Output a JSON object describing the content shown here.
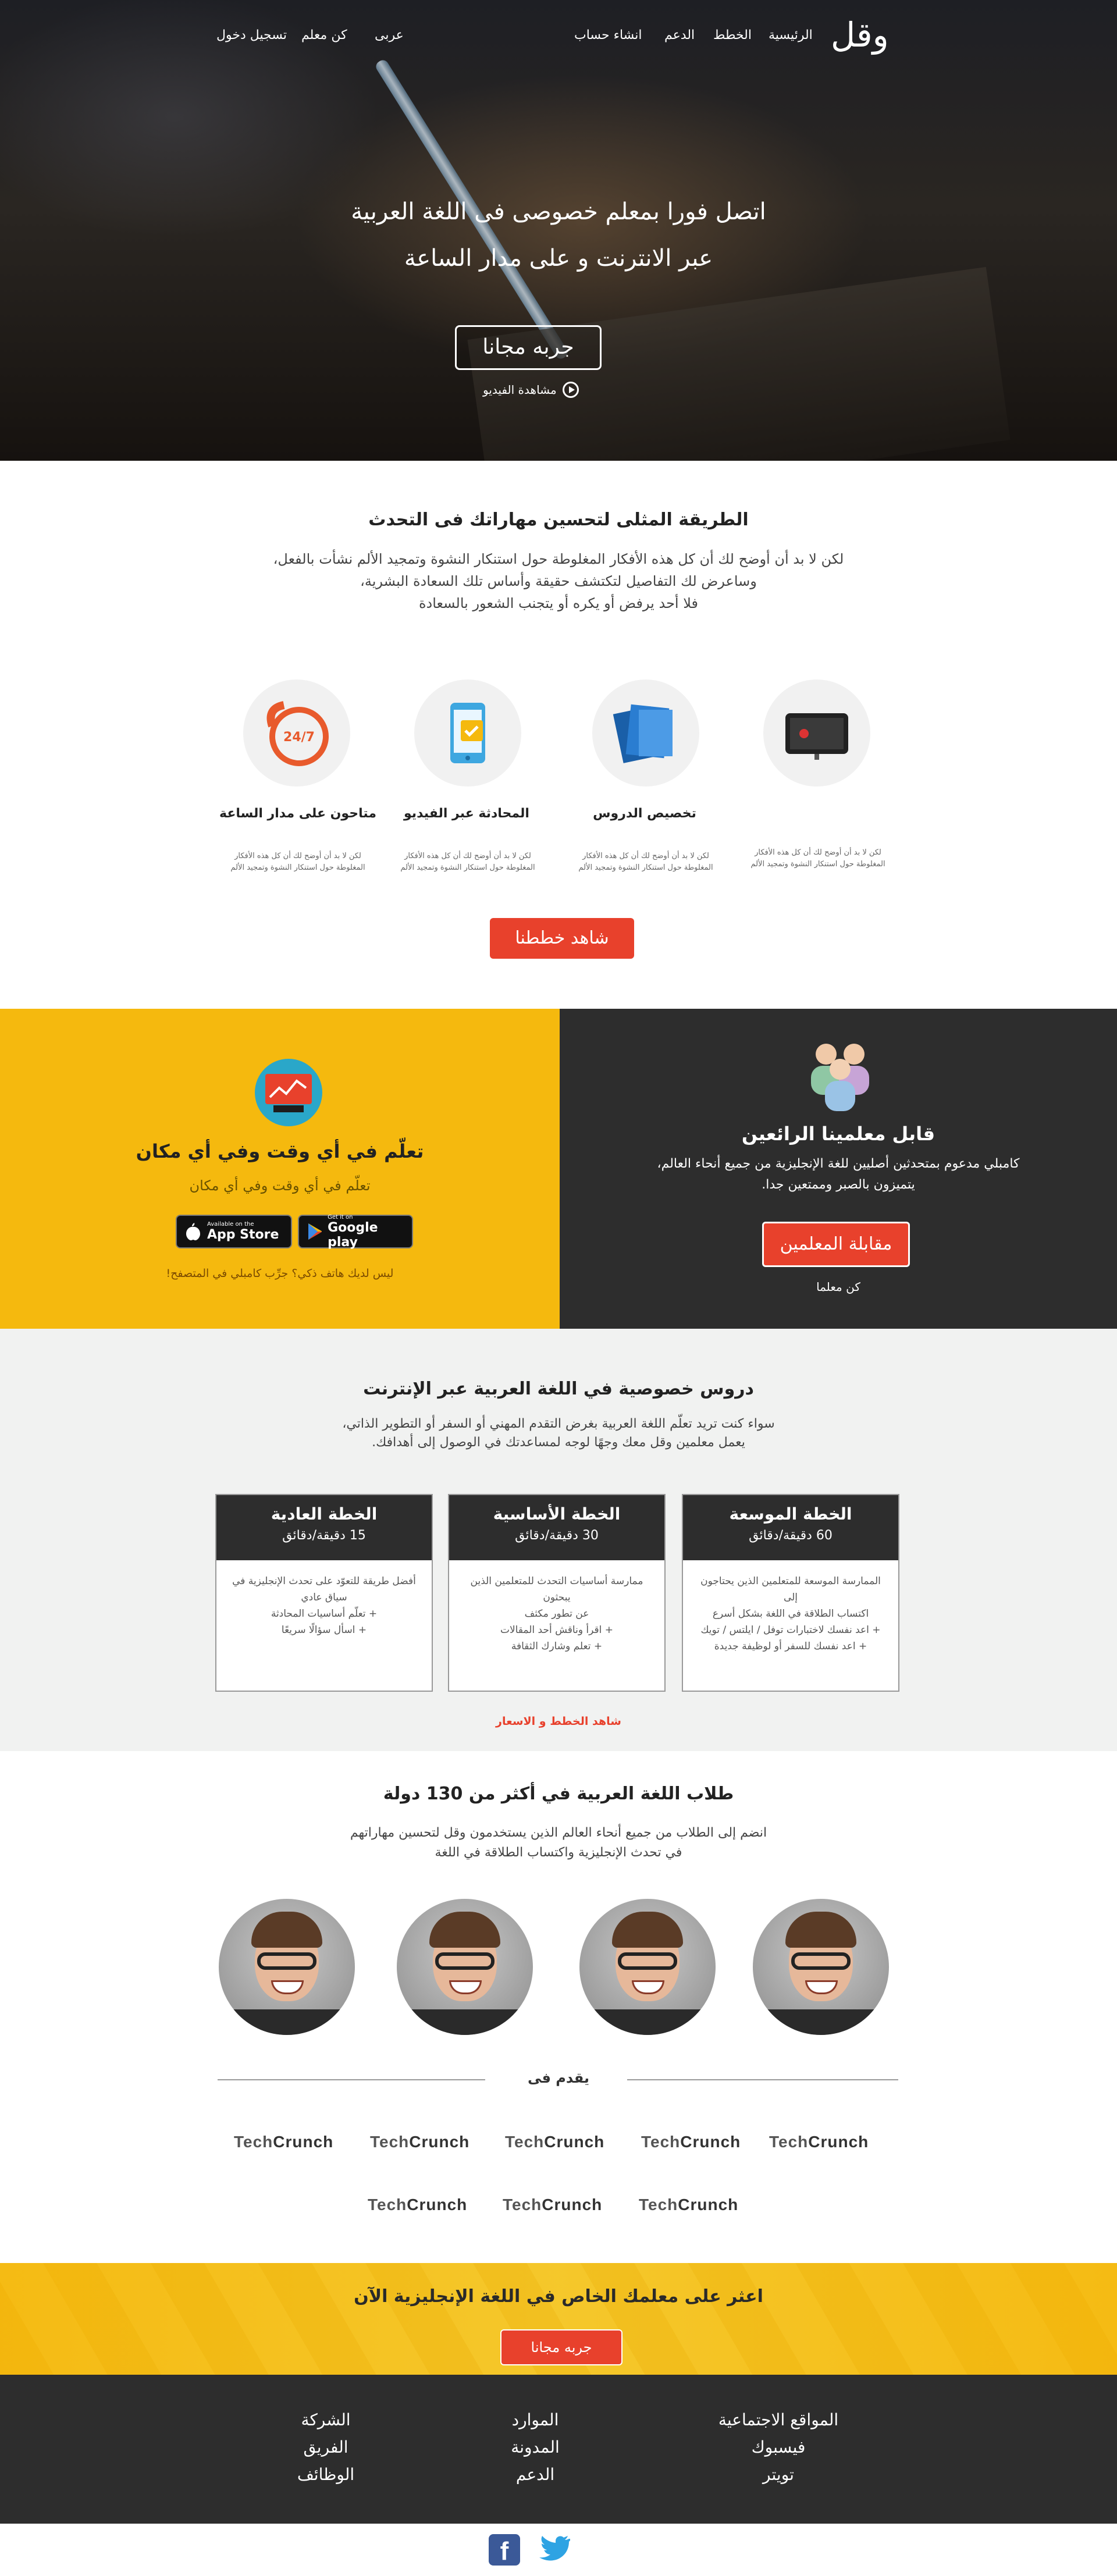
{
  "nav": {
    "logo": "وقل",
    "links": [
      "الرئيسية",
      "الخطط",
      "الدعم",
      "انشاء حساب"
    ],
    "language": "عربى",
    "become_teacher": "كن معلم",
    "login": "تسجيل دخول"
  },
  "hero": {
    "line1": "اتصل فورا بمعلم خصوصى فى اللغة العربية",
    "line2": "عبر الانترنت و على  مدار الساعة",
    "try_button": "جربه مجانا",
    "video_link": "مشاهدة الفيديو"
  },
  "features": {
    "title": "الطريقة المثلى لتحسين مهاراتك فى التحدث",
    "para": [
      "لكن لا بد أن أوضح لك أن كل هذه الأفكار المغلوطة حول استنكار  النشوة وتمجيد الألم نشأت بالفعل،",
      "وساعرض لك التفاصيل لتكتشف حقيقة وأساس تلك السعادة البشرية،",
      "فلا أحد يرفض أو يكره أو يتجنب الشعور بالسعادة"
    ],
    "items": [
      {
        "title": "",
        "desc": "لكن لا بد أن أوضح لك أن كل هذه الأفكار المغلوطة حول استنكار  النشوة وتمجيد الألم",
        "icon": "video-chat-icon"
      },
      {
        "title": "تخصيص الدروس",
        "desc": "لكن لا بد أن أوضح لك أن كل هذه الأفكار المغلوطة حول استنكار  النشوة وتمجيد الألم",
        "icon": "documents-icon"
      },
      {
        "title": "المحادثة عبر الفيديو",
        "desc": "لكن لا بد أن أوضح لك أن كل هذه الأفكار المغلوطة حول استنكار  النشوة وتمجيد الألم",
        "icon": "phone-check-icon"
      },
      {
        "title": "متاحون على مدار الساعة",
        "desc": "لكن لا بد أن أوضح لك أن كل هذه الأفكار المغلوطة حول استنكار  النشوة وتمجيد الألم",
        "icon": "support-24-7-icon"
      }
    ],
    "badge_24_7": "24/7",
    "plans_button": "شاهد خططنا"
  },
  "learn": {
    "title": "تعلّم في أي وقت وفي أي مكان",
    "subtitle": "تعلّم في أي وقت وفي أي مكان",
    "appstore_small": "Available on the",
    "appstore_big": "App Store",
    "google_small": "Get it on",
    "google_big": "Google play",
    "no_phone": "ليس لديك هاتف ذكي؟ جرِّب كامبلي في المتصفح!"
  },
  "teachers": {
    "title": "قابل معلمينا الرائعين",
    "line1": "كامبلي مدعوم بمتحدثين أصليين للغة الإنجليزية من جميع أنحاء العالم،",
    "line2": "يتميزون بالصبر وممتعين جدا.",
    "meet_button": "مقابلة المعلمين",
    "be_teacher": "كن معلما"
  },
  "plans": {
    "title": "دروس خصوصية في اللغة العربية عبر الإنترنت",
    "line1": "سواء كنت تريد تعلّم اللغة العربية بغرض التقدم المهني أو السفر أو التطوير الذاتي،",
    "line2": "يعمل معلمين وقل معك وجهًا لوجه لمساعدتك في الوصول إلى أهدافك.",
    "cards": [
      {
        "name": "الخطة الموسعة",
        "duration": "60 دقيقة/دقائق",
        "lines": [
          "الممارسة الموسعة للمتعلمين الذين يحتاجون إلى",
          "اكتساب الطلاقة في اللغة بشكل أسرع",
          "+ اعد نفسك لاختبارات توفل / ايلتس / تويك",
          "+ اعد نفسك للسفر أو لوظيفة جديدة"
        ]
      },
      {
        "name": "الخطة الأساسية",
        "duration": "30 دقيقة/دقائق",
        "lines": [
          "ممارسة أساسيات التحدث للمتعلمين الذين يبحثون",
          "عن تطور مكثف",
          "+ اقرأ وناقش أحد المقالات",
          "+ تعلم وشارك الثقافة"
        ]
      },
      {
        "name": "الخطة العادية",
        "duration": "15 دقيقة/دقائق",
        "lines": [
          "أفضل طريقة للتعوّد على تحدث الإنجليزية في",
          "سياق عادي",
          "+ تعلّم أساسيات المحادثة",
          "+ اسأل سؤالًا سريعًا"
        ]
      }
    ],
    "link": "شاهد الخطط و الاسعار"
  },
  "students": {
    "title": "طلاب اللغة العربية في أكثر من 130 دولة",
    "line1": "انضم إلى الطلاب من جميع أنحاء العالم الذين يستخدمون وقل لتحسين مهاراتهم",
    "line2": "في تحدث الإنجليزية واكتساب الطلاقة في اللغة",
    "featured": "يقدم فى",
    "press": [
      {
        "a": "Tech",
        "b": "Crunch"
      },
      {
        "a": "Tech",
        "b": "Crunch"
      },
      {
        "a": "Tech",
        "b": "Crunch"
      },
      {
        "a": "Tech",
        "b": "Crunch"
      },
      {
        "a": "Tech",
        "b": "Crunch"
      },
      {
        "a": "Tech",
        "b": "Crunch"
      },
      {
        "a": "Tech",
        "b": "Crunch"
      },
      {
        "a": "Tech",
        "b": "Crunch"
      }
    ]
  },
  "cta": {
    "title": "اعثر على معلمك الخاص في اللغة الإنجليزية الآن",
    "button": "جربه مجانا"
  },
  "footer": {
    "social_col": [
      "المواقع الاجتماعية",
      "فيسبوك",
      "تويتر"
    ],
    "resources_col": [
      "الموارد",
      "المدونة",
      "الدعم"
    ],
    "company_col": [
      "الشركة",
      "الفريق",
      "الوظائف"
    ]
  },
  "social": {
    "facebook": "f",
    "twitter_icon": "twitter-icon"
  },
  "colors": {
    "accent": "#e8412c",
    "yellow": "#f5b90e",
    "dark": "#2d2d2d"
  }
}
